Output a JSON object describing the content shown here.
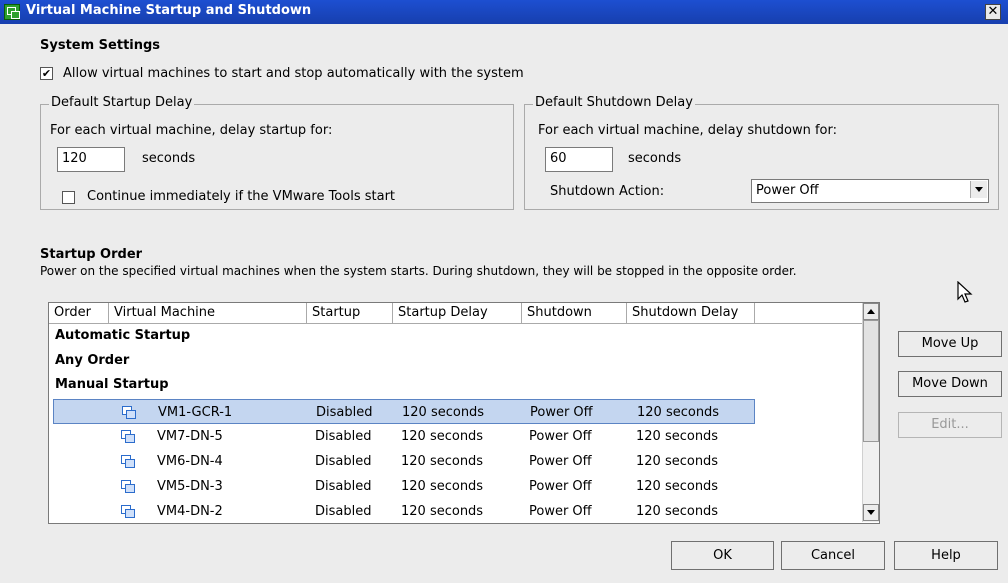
{
  "window": {
    "title": "Virtual Machine Startup and Shutdown",
    "close_glyph": "✕"
  },
  "system_settings": {
    "heading": "System Settings",
    "allow_auto_label": "Allow virtual machines to start and stop automatically with the system",
    "allow_auto_checked": true
  },
  "startup_delay": {
    "legend": "Default Startup Delay",
    "prompt": "For each virtual machine, delay startup for:",
    "value": "120",
    "unit": "seconds",
    "continue_label": "Continue immediately if the VMware Tools start",
    "continue_checked": false
  },
  "shutdown_delay": {
    "legend": "Default Shutdown Delay",
    "prompt": "For each virtual machine, delay shutdown for:",
    "value": "60",
    "unit": "seconds",
    "action_label": "Shutdown Action:",
    "action_value": "Power Off"
  },
  "startup_order": {
    "heading": "Startup Order",
    "description": "Power on the specified virtual machines when the system starts. During shutdown, they will be stopped in the opposite order.",
    "columns": [
      "Order",
      "Virtual Machine",
      "Startup",
      "Startup Delay",
      "Shutdown",
      "Shutdown Delay"
    ],
    "groups": [
      "Automatic Startup",
      "Any Order",
      "Manual Startup"
    ],
    "rows": [
      {
        "vm": "VM1-GCR-1",
        "startup": "Disabled",
        "startup_delay": "120 seconds",
        "shutdown": "Power Off",
        "shutdown_delay": "120 seconds",
        "selected": true
      },
      {
        "vm": "VM7-DN-5",
        "startup": "Disabled",
        "startup_delay": "120 seconds",
        "shutdown": "Power Off",
        "shutdown_delay": "120 seconds"
      },
      {
        "vm": "VM6-DN-4",
        "startup": "Disabled",
        "startup_delay": "120 seconds",
        "shutdown": "Power Off",
        "shutdown_delay": "120 seconds"
      },
      {
        "vm": "VM5-DN-3",
        "startup": "Disabled",
        "startup_delay": "120 seconds",
        "shutdown": "Power Off",
        "shutdown_delay": "120 seconds"
      },
      {
        "vm": "VM4-DN-2",
        "startup": "Disabled",
        "startup_delay": "120 seconds",
        "shutdown": "Power Off",
        "shutdown_delay": "120 seconds"
      }
    ]
  },
  "side_buttons": {
    "move_up": "Move Up",
    "move_down": "Move Down",
    "edit": "Edit..."
  },
  "footer": {
    "ok": "OK",
    "cancel": "Cancel",
    "help": "Help"
  },
  "colors": {
    "titlebar": "#1d4fd1",
    "dialog_bg": "#ececec",
    "selection": "#c4d6f0"
  }
}
